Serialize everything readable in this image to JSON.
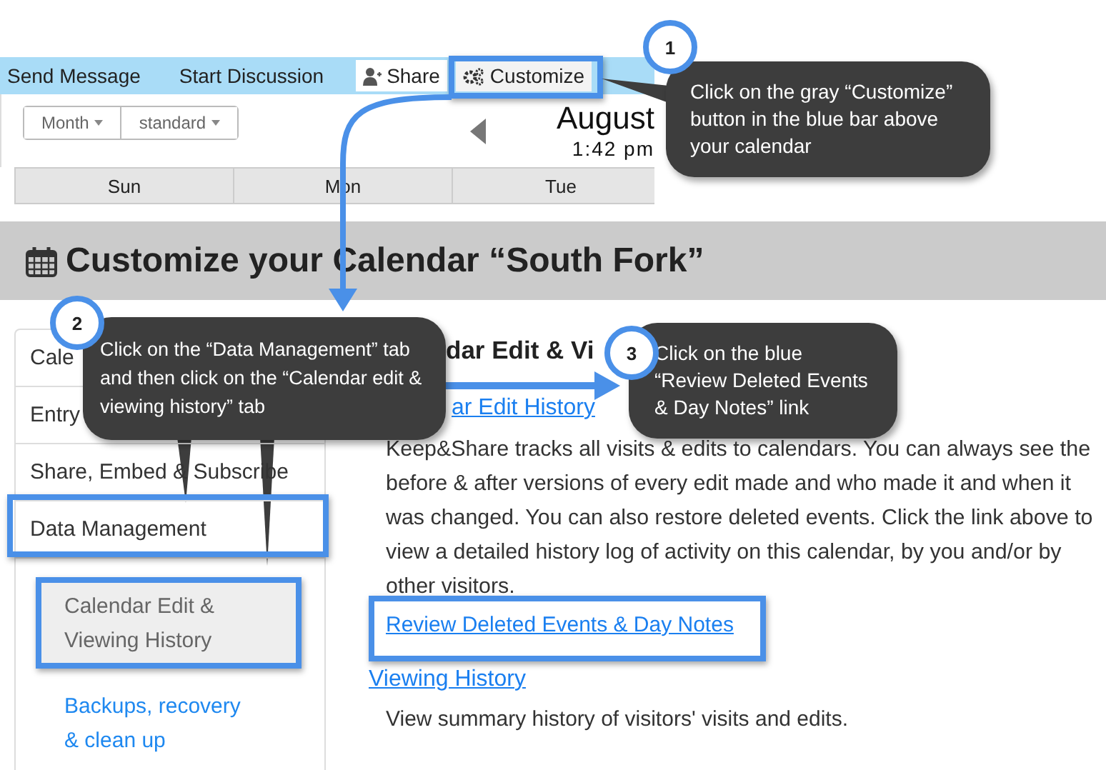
{
  "toolbar": {
    "links": [
      "Send Message",
      "Start Discussion"
    ],
    "buttons": [
      {
        "label": "Share",
        "kind": "share"
      },
      {
        "label": "Customize",
        "kind": "customize"
      }
    ]
  },
  "calendar": {
    "view_buttons": [
      "Month",
      "standard"
    ],
    "month": "August",
    "time": "1:42 pm",
    "days": [
      "Sun",
      "Mon",
      "Tue"
    ]
  },
  "page_title": "Customize your Calendar “South Fork”",
  "sidebar": {
    "items": [
      "Cale",
      "Entry",
      "Share, Embed & Subscribe",
      "Data Management"
    ],
    "sub_items": [
      {
        "label": "Calendar Edit & Viewing History",
        "selected": true
      },
      {
        "label": "Backups, recovery & clean up",
        "selected": false
      }
    ]
  },
  "content": {
    "heading": "dar Edit & Vi",
    "edit_history_link": "ar Edit History",
    "description": "Keep&Share tracks all visits & edits to calendars. You can always see the before & after versions of every edit made and who made it and when it was changed. You can also restore deleted events. Click the link above to view a detailed history log of activity on this calendar, by you and/or by other visitors.",
    "review_link": "Review Deleted Events & Day Notes",
    "viewing_link": "Viewing History",
    "viewing_description": "View summary history of visitors' visits and edits."
  },
  "callouts": [
    {
      "number": "1",
      "text": "Click on the gray “Customize” button in the blue bar above your calendar"
    },
    {
      "number": "2",
      "text": "Click on the “Data Management” tab and then click on the “Calendar edit & viewing history” tab"
    },
    {
      "number": "3",
      "text": "Click on the blue “Review Deleted Events & Day Notes” link"
    }
  ]
}
